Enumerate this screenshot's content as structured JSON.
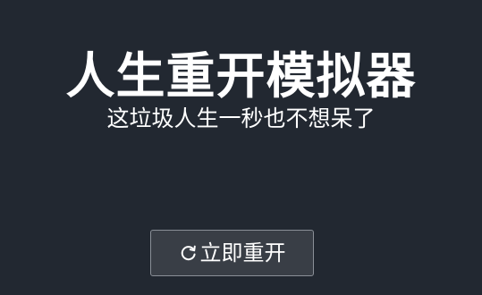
{
  "app": {
    "title": "人生重开模拟器",
    "subtitle": "这垃圾人生一秒也不想呆了"
  },
  "actions": {
    "restart_label": "立即重开",
    "restart_icon": "refresh-icon"
  },
  "colors": {
    "background": "#222831",
    "button_background": "#393e46",
    "button_border": "#8a8f97",
    "text": "#ffffff"
  }
}
